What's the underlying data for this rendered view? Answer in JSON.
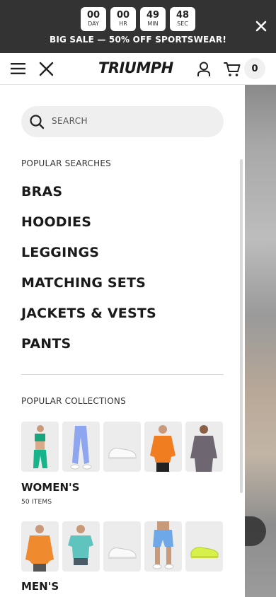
{
  "promo": {
    "countdown": [
      {
        "value": "00",
        "unit": "DAY"
      },
      {
        "value": "00",
        "unit": "HR"
      },
      {
        "value": "49",
        "unit": "MIN"
      },
      {
        "value": "48",
        "unit": "SEC"
      }
    ],
    "message": "BIG SALE — 50% OFF SPORTSWEAR!",
    "close_icon": "close-icon"
  },
  "header": {
    "menu_icon": "hamburger-icon",
    "close_icon": "close-icon",
    "logo": "TRIUMPH",
    "account_icon": "user-icon",
    "cart_icon": "cart-icon",
    "cart_count": "0"
  },
  "drawer": {
    "search": {
      "placeholder": "SEARCH",
      "icon": "search-icon"
    },
    "popular_searches": {
      "label": "POPULAR SEARCHES",
      "items": [
        "BRAS",
        "HOODIES",
        "LEGGINGS",
        "MATCHING SETS",
        "JACKETS & VESTS",
        "PANTS"
      ]
    },
    "popular_collections": {
      "label": "POPULAR COLLECTIONS",
      "collections": [
        {
          "title": "WOMEN'S",
          "count": "50 ITEMS"
        },
        {
          "title": "MEN'S"
        }
      ]
    }
  },
  "colors": {
    "promo_bg": "#333333",
    "text": "#1a1a1a",
    "search_bg": "#efefef",
    "badge_bg": "#f0f0f0"
  }
}
